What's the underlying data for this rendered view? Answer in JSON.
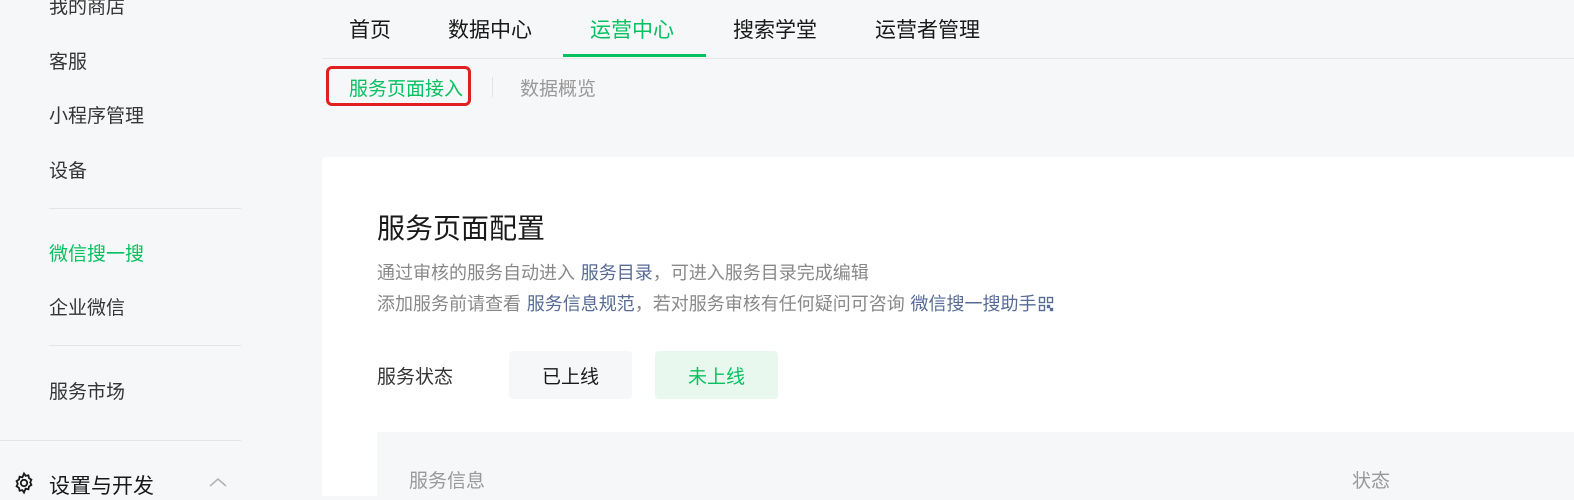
{
  "sidebar": {
    "items": [
      {
        "label": "我的商店"
      },
      {
        "label": "客服"
      },
      {
        "label": "小程序管理"
      },
      {
        "label": "设备"
      },
      {
        "label": "微信搜一搜"
      },
      {
        "label": "企业微信"
      },
      {
        "label": "服务市场"
      }
    ],
    "settings_label": "设置与开发",
    "settings_icon": "gear-icon",
    "expand_icon": "chevron-up-icon"
  },
  "topnav": {
    "tabs": [
      {
        "label": "首页"
      },
      {
        "label": "数据中心"
      },
      {
        "label": "运营中心"
      },
      {
        "label": "搜索学堂"
      },
      {
        "label": "运营者管理"
      }
    ],
    "active_tab": "运营中心"
  },
  "subtabs": {
    "active": "服务页面接入",
    "inactive": "数据概览"
  },
  "main": {
    "title": "服务页面配置",
    "desc1_prefix": "通过审核的服务自动进入 ",
    "desc1_link": "服务目录",
    "desc1_suffix": "，可进入服务目录完成编辑",
    "desc2_prefix": "添加服务前请查看 ",
    "desc2_link1": "服务信息规范",
    "desc2_middle": "，若对服务审核有任何疑问可咨询 ",
    "desc2_link2": "微信搜一搜助手",
    "status_label": "服务状态",
    "status_options": [
      "已上线",
      "未上线"
    ],
    "selected_status": "未上线",
    "table_headers": [
      "服务信息",
      "状态"
    ]
  },
  "colors": {
    "accent": "#07c160",
    "link": "#576b95",
    "highlight_box": "#e02020"
  }
}
